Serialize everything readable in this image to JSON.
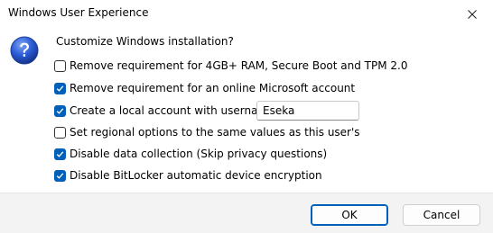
{
  "window": {
    "title": "Windows User Experience"
  },
  "dialog": {
    "prompt": "Customize Windows installation?",
    "options": [
      {
        "label": "Remove requirement for 4GB+ RAM, Secure Boot and TPM 2.0",
        "checked": false
      },
      {
        "label": "Remove requirement for an online Microsoft account",
        "checked": true
      },
      {
        "label": "Create a local account with username:",
        "checked": true
      },
      {
        "label": "Set regional options to the same values as this user's",
        "checked": false
      },
      {
        "label": "Disable data collection (Skip privacy questions)",
        "checked": true
      },
      {
        "label": "Disable BitLocker automatic device encryption",
        "checked": true
      }
    ],
    "username_value": "Eseka"
  },
  "buttons": {
    "ok_label": "OK",
    "cancel_label": "Cancel"
  },
  "colors": {
    "accent": "#005fb8",
    "icon_blue": "#2a5bd7",
    "footer_bg": "#f3f3f3"
  },
  "icons": {
    "question": "question-icon",
    "close": "close-icon",
    "check": "checkmark-icon"
  }
}
